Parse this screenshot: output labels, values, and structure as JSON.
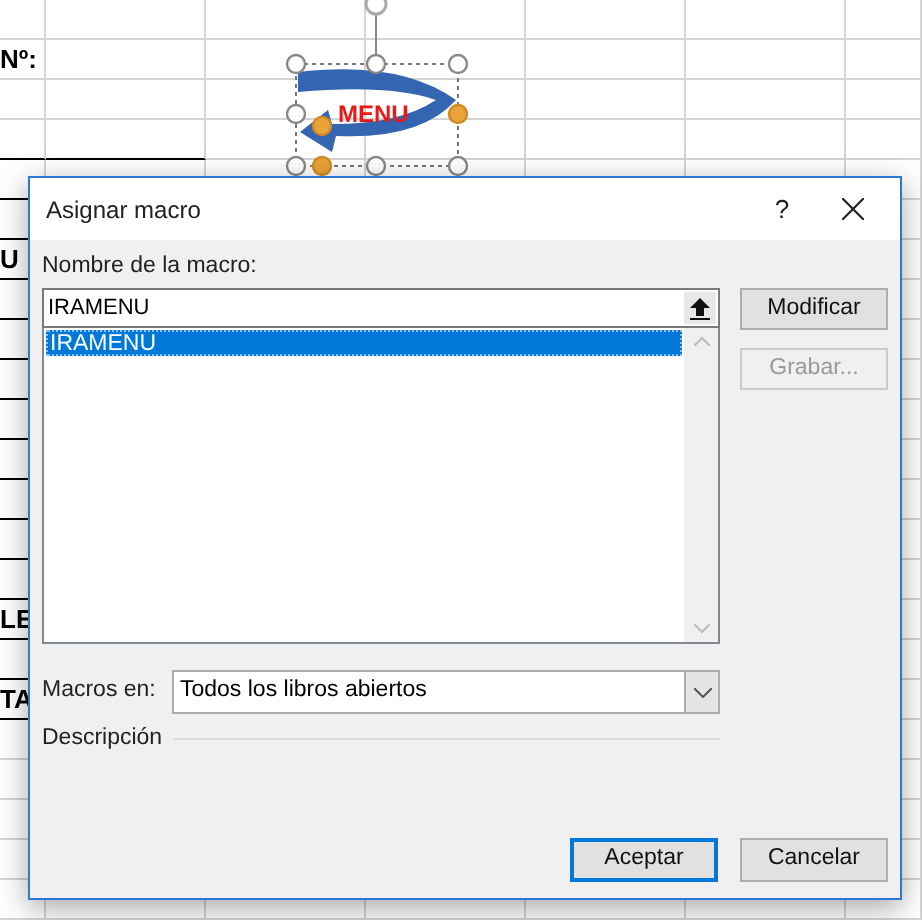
{
  "sheet": {
    "labels": [
      {
        "text": "Nº:"
      },
      {
        "text": "U"
      },
      {
        "text": "LE"
      },
      {
        "text": "TA"
      }
    ],
    "shape": {
      "text": "MENU"
    }
  },
  "dialog": {
    "title": "Asignar macro",
    "help": "?",
    "name_label": "Nombre de la macro:",
    "name_value": "IRAMENU",
    "macros": [
      {
        "label": "IRAMENU",
        "selected": true
      }
    ],
    "side_buttons": [
      {
        "label": "Modificar",
        "disabled": false
      },
      {
        "label": "Grabar...",
        "disabled": true
      }
    ],
    "macros_in_label": "Macros en:",
    "macros_in_value": "Todos los libros abiertos",
    "description_label": "Descripción",
    "buttons": [
      {
        "label": "Aceptar",
        "default": true
      },
      {
        "label": "Cancelar",
        "default": false
      }
    ]
  }
}
